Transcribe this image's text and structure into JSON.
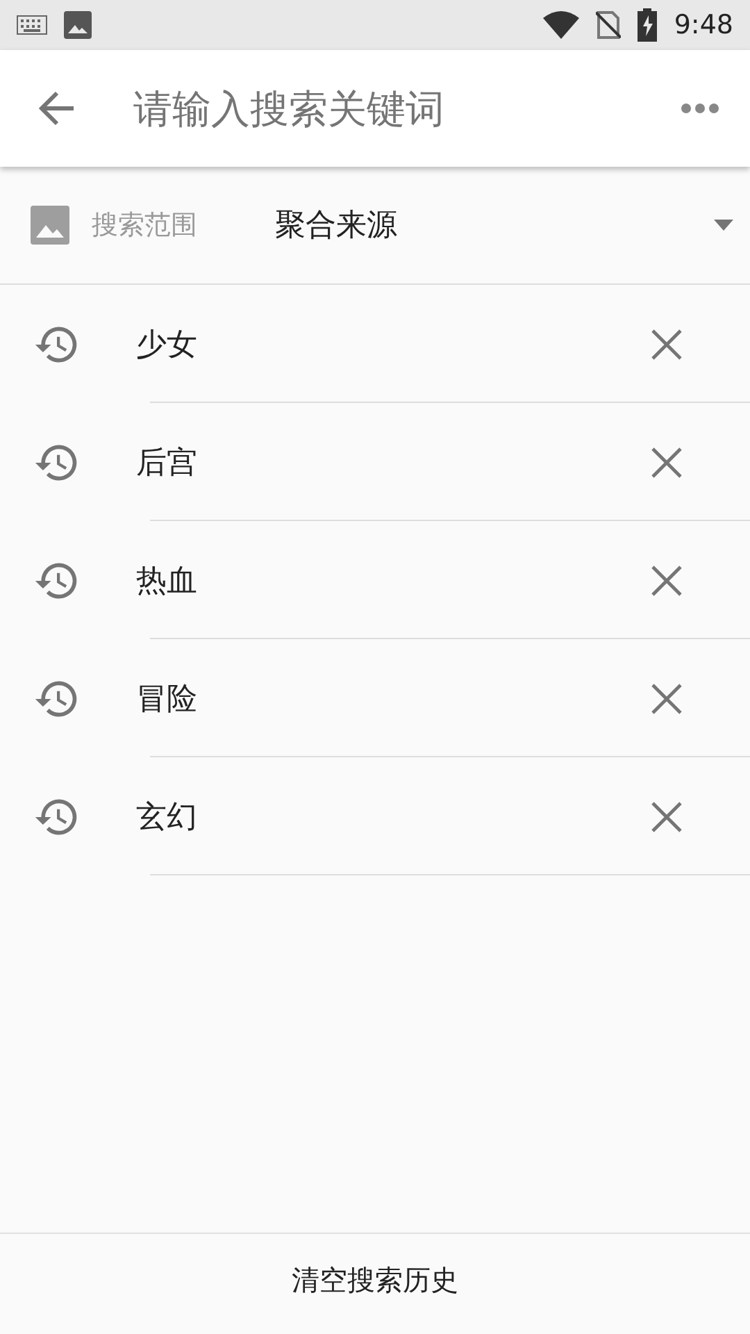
{
  "status_bar": {
    "time": "9:48"
  },
  "toolbar": {
    "placeholder": "请输入搜索关键词"
  },
  "scope": {
    "label": "搜索范围",
    "value": "聚合来源"
  },
  "history": [
    {
      "text": "少女"
    },
    {
      "text": "后宫"
    },
    {
      "text": "热血"
    },
    {
      "text": "冒险"
    },
    {
      "text": "玄幻"
    }
  ],
  "footer": {
    "button": "清空搜索历史"
  }
}
